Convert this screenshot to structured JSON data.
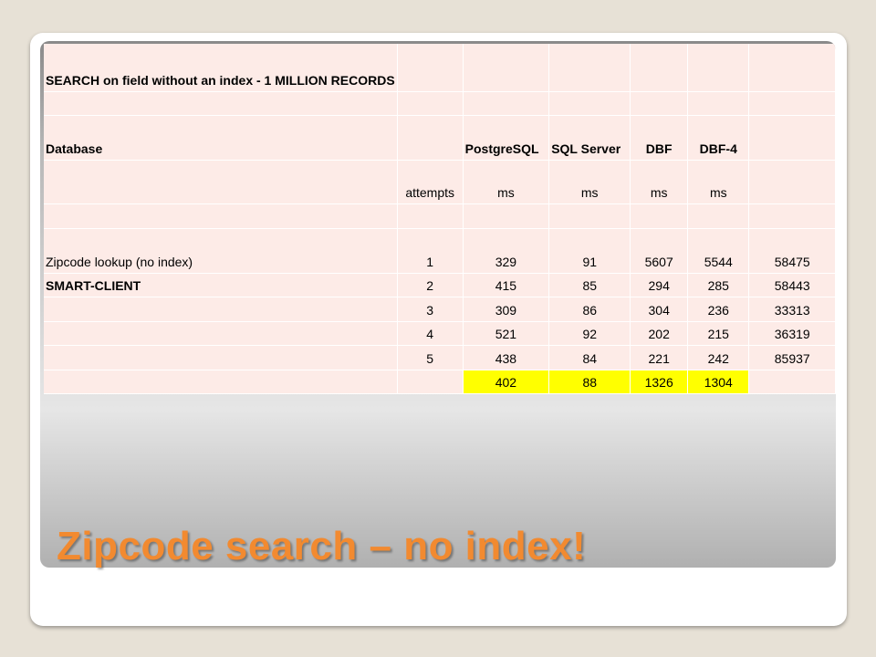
{
  "slide": {
    "title": "Zipcode search – no index!",
    "colors": {
      "title": "#f28a30",
      "table_bg": "#fdebe7",
      "highlight": "#ffff00"
    }
  },
  "table": {
    "heading": "SEARCH on field  without  an index - 1 MILLION RECORDS",
    "database_label": "Database",
    "columns": [
      "PostgreSQL",
      "SQL Server",
      "DBF",
      "DBF-4"
    ],
    "attempts_label": "attempts",
    "units": [
      "ms",
      "ms",
      "ms",
      "ms"
    ],
    "rows": [
      {
        "label": "Zipcode lookup (no index)",
        "attempt": "1",
        "values": [
          "329",
          "91",
          "5607",
          "5544",
          "58475"
        ]
      },
      {
        "label": "SMART-CLIENT",
        "attempt": "2",
        "values": [
          "415",
          "85",
          "294",
          "285",
          "58443"
        ]
      },
      {
        "label": "",
        "attempt": "3",
        "values": [
          "309",
          "86",
          "304",
          "236",
          "33313"
        ]
      },
      {
        "label": "",
        "attempt": "4",
        "values": [
          "521",
          "92",
          "202",
          "215",
          "36319"
        ]
      },
      {
        "label": "",
        "attempt": "5",
        "values": [
          "438",
          "84",
          "221",
          "242",
          "85937"
        ]
      }
    ],
    "averages": [
      "402",
      "88",
      "1326",
      "1304"
    ]
  }
}
